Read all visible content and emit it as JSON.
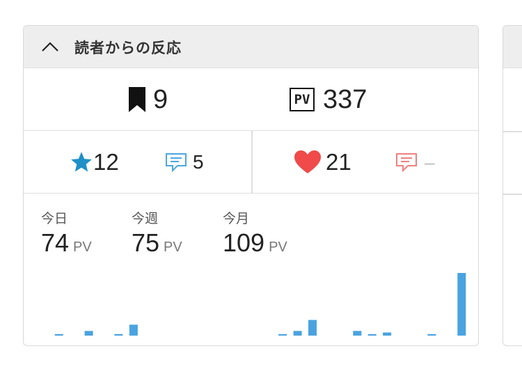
{
  "header": {
    "title": "読者からの反応",
    "chevron_icon": "chevron-up-icon"
  },
  "summary": {
    "bookmarks": {
      "icon": "bookmark-icon",
      "count": "9"
    },
    "pageviews": {
      "icon": "pv-icon",
      "icon_text": "PV",
      "count": "337"
    }
  },
  "reactions": {
    "stars": {
      "icon": "star-icon",
      "count": "12",
      "color": "#1e90c8"
    },
    "comments_left": {
      "icon": "comment-icon",
      "count": "5",
      "color": "#4aa8e0"
    },
    "likes": {
      "icon": "heart-icon",
      "count": "21",
      "color": "#f04a4a"
    },
    "comments_right": {
      "icon": "comment-icon",
      "count": "–",
      "color": "#f08080"
    }
  },
  "pv_stats": [
    {
      "label": "今日",
      "value": "74",
      "unit": "PV"
    },
    {
      "label": "今週",
      "value": "75",
      "unit": "PV"
    },
    {
      "label": "今月",
      "value": "109",
      "unit": "PV"
    }
  ],
  "chart_data": {
    "type": "bar",
    "color": "#4aa3e0",
    "values": [
      1,
      0,
      3,
      0,
      1,
      7,
      0,
      0,
      0,
      0,
      0,
      0,
      0,
      0,
      0,
      1,
      3,
      10,
      0,
      0,
      3,
      1,
      2,
      0,
      0,
      1,
      0,
      40
    ],
    "ylim": [
      0,
      40
    ]
  }
}
